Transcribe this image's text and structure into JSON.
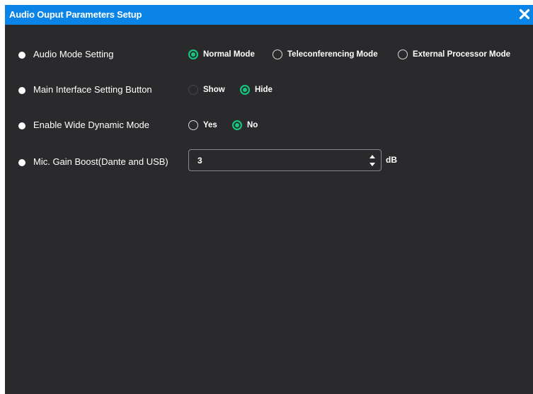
{
  "dialog": {
    "title": "Audio Ouput Parameters Setup",
    "close_icon": "close-x-icon"
  },
  "audio_mode": {
    "label": "Audio Mode Setting",
    "options": [
      "Normal Mode",
      "Teleconferencing Mode",
      "External Processor Mode"
    ],
    "selected": "Normal Mode"
  },
  "main_interface_button": {
    "label": "Main Interface Setting Button",
    "options": [
      "Show",
      "Hide"
    ],
    "selected": "Hide"
  },
  "wide_dynamic": {
    "label": "Enable Wide Dynamic Mode",
    "options": [
      "Yes",
      "No"
    ],
    "selected": "No"
  },
  "mic_gain": {
    "label": "Mic. Gain Boost(Dante and USB)",
    "value": "3",
    "unit": "dB"
  },
  "colors": {
    "title_bar": "#0a84e6",
    "panel_background": "#2a2a2c",
    "radio_selected": "#15c77f",
    "text": "#ffffff"
  }
}
